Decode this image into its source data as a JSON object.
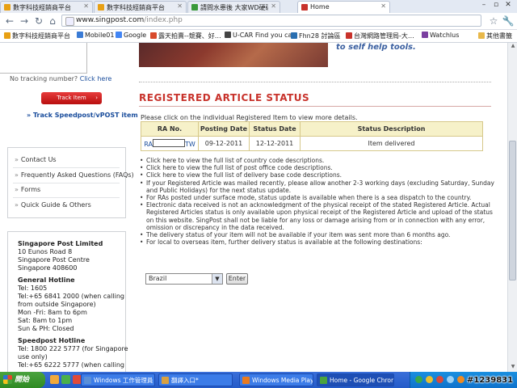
{
  "browser": {
    "tabs": [
      {
        "title": "數字科技經銷商平台",
        "active": false,
        "color": "#e8a013"
      },
      {
        "title": "數字科技經銷商平台",
        "active": false,
        "color": "#e8a013"
      },
      {
        "title": "請問水患後 大家WD硬碟R",
        "active": false,
        "color": "#3a9a3a"
      },
      {
        "title": "Home",
        "active": true,
        "color": "#c8322b"
      }
    ],
    "url_host": "www.singpost.com",
    "url_path": "/index.php",
    "bookmarks": [
      {
        "label": "數字科技經銷商平台",
        "color": "#e8a013"
      },
      {
        "label": "Mobile01",
        "color": "#3a7bd5"
      },
      {
        "label": "Google",
        "color": "#4285f4"
      },
      {
        "label": "露天拍賣--競賽、好…",
        "color": "#d84a2b"
      },
      {
        "label": "U-CAR Find you car",
        "color": "#444444"
      },
      {
        "label": "Fhn28 討論區",
        "color": "#2a6fb0"
      },
      {
        "label": "台灣網路管理局-大…",
        "color": "#c8322b"
      },
      {
        "label": "Watchlus",
        "color": "#7b3fa0"
      },
      {
        "label": "其他書籤",
        "color": "#e8b84a"
      }
    ]
  },
  "sidebar": {
    "no_tracking_text": "No tracking number?",
    "click_here": "Click here",
    "track_button": "Track Item",
    "track_link": "» Track Speedpost/vPOST item",
    "nav": [
      "Contact Us",
      "Frequently Asked Questions (FAQs)",
      "Forms",
      "Quick Guide & Others"
    ],
    "contact": {
      "org": "Singapore Post Limited",
      "address": [
        "10 Eunos Road 8",
        "Singapore Post Centre",
        "Singapore 408600"
      ],
      "hotline_title": "General Hotline",
      "hotline_lines": [
        "Tel: 1605",
        "Tel:+65 6841 2000 (when calling",
        "from outside Singapore)",
        "Mon -Fri: 8am to 6pm",
        "Sat: 8am to 1pm",
        "Sun & PH: Closed"
      ],
      "speedpost_title": "Speedpost Hotline",
      "speedpost_lines": [
        "Tel: 1800 222 5777 (for Singapore",
        "use only)",
        "Tel:+65 6222 5777 (when calling"
      ]
    }
  },
  "banner": {
    "tagline": "to self help tools."
  },
  "main": {
    "heading": "REGISTERED ARTICLE STATUS",
    "intro": "Please click on the individual Registered Item to view more details.",
    "table": {
      "headers": [
        "RA No.",
        "Posting Date",
        "Status Date",
        "Status Description"
      ],
      "row": {
        "ra_prefix": "RA",
        "ra_suffix": "TW",
        "posting_date": "09-12-2011",
        "status_date": "12-12-2011",
        "status": "Item delivered"
      }
    },
    "info": [
      "Click here to view the full list of country code descriptions.",
      "Click here to view the full list of post office code descriptions.",
      "Click here to view the full list of delivery base code descriptions.",
      "If your Registered Article was mailed recently, please allow another 2-3 working days (excluding Saturday, Sunday and Public Holidays) for the next status update.",
      "For RAs posted under surface mode, status update is available when there is a sea dispatch to the country.",
      "Electronic data received is not an acknowledgment of the physical receipt of the stated Registered Article. Actual Registered Articles status is only available upon physical receipt of the Registered Article and upload of the status on this website. SingPost shall not be liable for any loss or damage arising from or in connection with any error, omission or discrepancy in the data received.",
      "The delivery status of your item will not be available if your item was sent more than 6 months ago.",
      "For local to overseas item, further delivery status is available at the following destinations:"
    ],
    "country_selected": "Brazil",
    "enter_label": "Enter"
  },
  "taskbar": {
    "start_label": "開始",
    "tasks": [
      {
        "label": "Windows 工作管理員",
        "color": "#5a8fd8"
      },
      {
        "label": "翻譯入口*",
        "color": "#d8a040"
      },
      {
        "label": "Windows Media Player",
        "color": "#e87a20"
      },
      {
        "label": "Home - Google Chrome",
        "color": "#4aa33e",
        "active": true
      }
    ]
  },
  "watermark": "#1239831"
}
